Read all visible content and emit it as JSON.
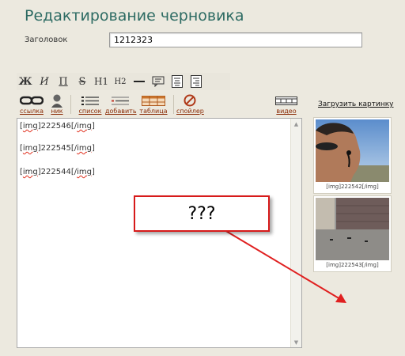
{
  "page": {
    "title": "Редактирование черновика"
  },
  "title_field": {
    "label": "Заголовок",
    "value": "1212323"
  },
  "toolbar_top": {
    "bold": "Ж",
    "italic": "И",
    "underline": "П",
    "strike": "S",
    "h1": "H1",
    "h2": "H2"
  },
  "toolbar_bottom": {
    "link": "ссылка",
    "nick": "ник",
    "list": "список",
    "add": "добавить",
    "table": "таблица",
    "spoiler": "спойлер",
    "video": "видео"
  },
  "upload": {
    "label": "Загрузить картинку"
  },
  "editor": {
    "lines": [
      {
        "pre": "[",
        "tag": "img",
        "mid": "]222546[/",
        "endtag": "img",
        "post": "]"
      },
      {
        "pre": "[",
        "tag": "img",
        "mid": "]222545[/",
        "endtag": "img",
        "post": "]"
      },
      {
        "pre": "[",
        "tag": "img",
        "mid": "]222544[/",
        "endtag": "img",
        "post": "]"
      }
    ]
  },
  "thumbnails": [
    {
      "caption": "[img]222542[/img]",
      "subject": "man in sunglasses outdoors"
    },
    {
      "caption": "[img]222543[/img]",
      "subject": "garage doors"
    }
  ],
  "annotation": {
    "text": "???",
    "color": "#d71a1a"
  }
}
